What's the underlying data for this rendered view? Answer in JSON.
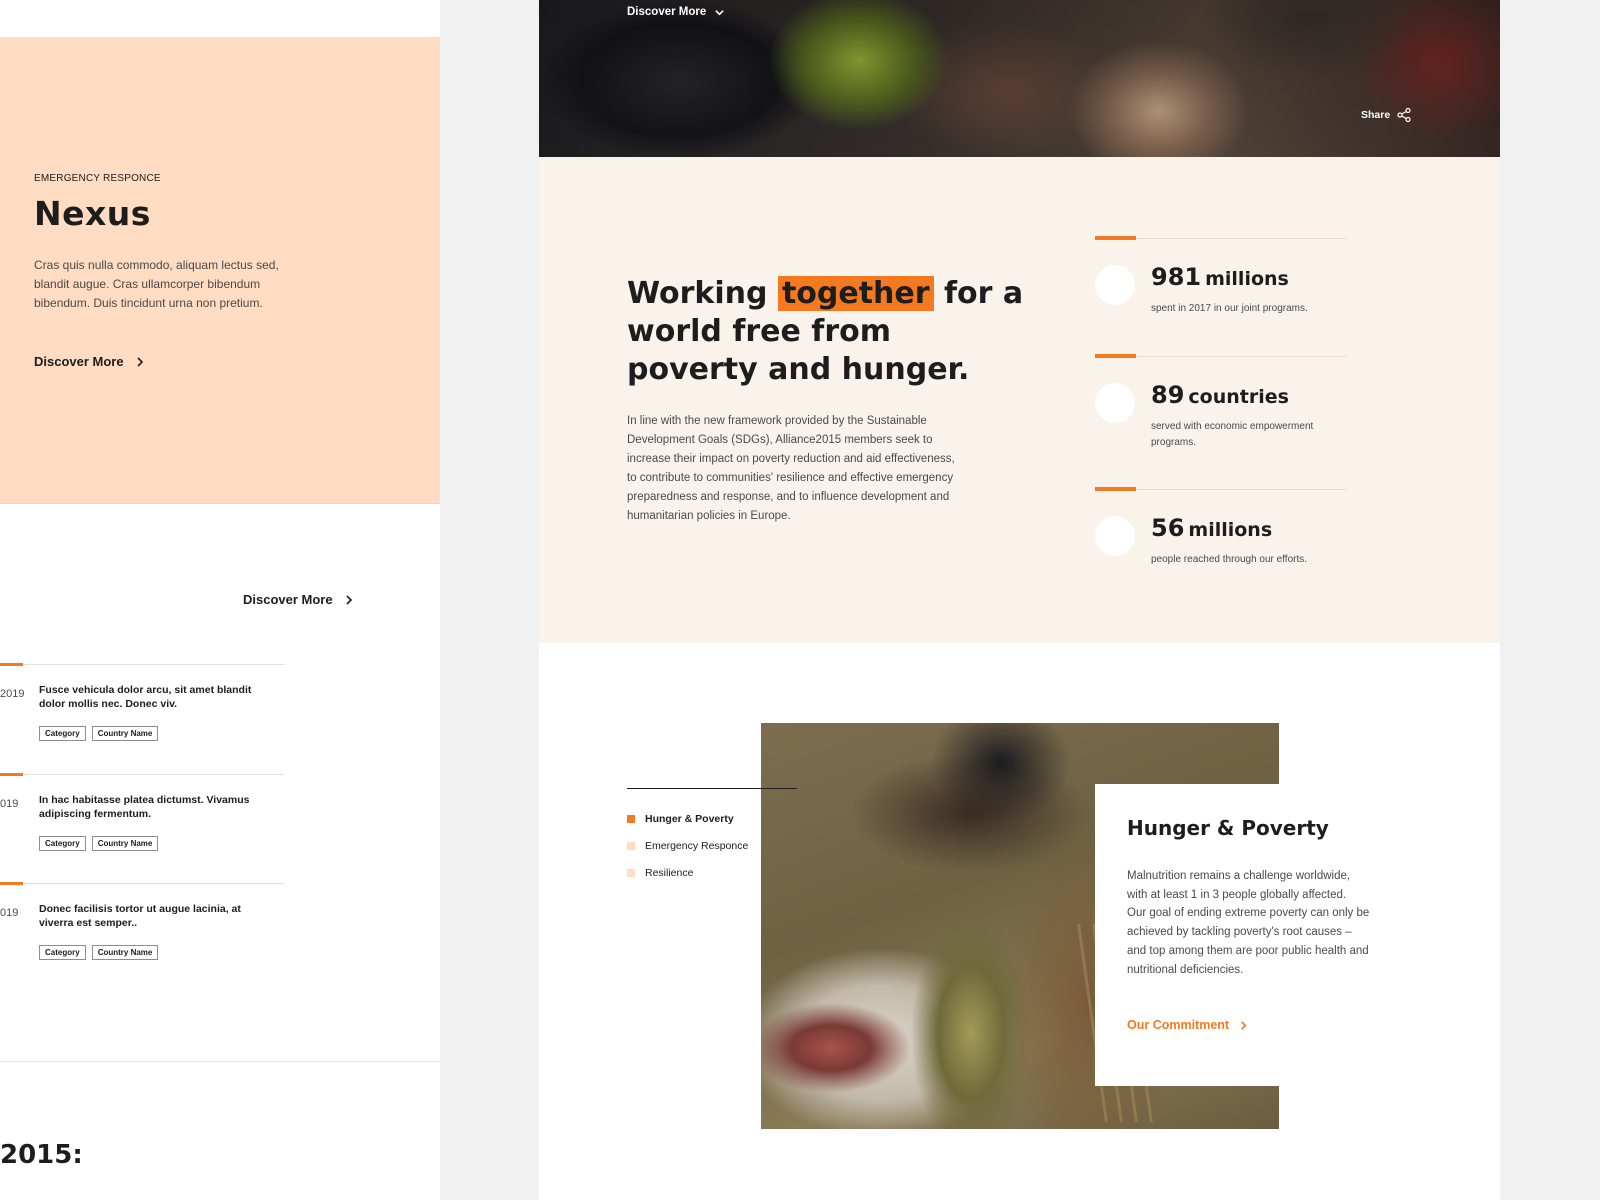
{
  "left_card": {
    "eyebrow": "EMERGENCY RESPONCE",
    "title": "Nexus",
    "body": "Cras quis nulla commodo, aliquam lectus sed, blandit augue. Cras ullamcorper bibendum bibendum. Duis tincidunt urna non pretium.",
    "link_label": "Discover More"
  },
  "left_section": {
    "link_label": "Discover More",
    "news": [
      {
        "date": "2019",
        "title": "Fusce vehicula dolor arcu, sit amet blandit dolor mollis nec. Donec viv.",
        "tags": [
          "Category",
          "Country Name"
        ]
      },
      {
        "date": "019",
        "title": "In hac habitasse platea dictumst. Vivamus adipiscing fermentum.",
        "tags": [
          "Category",
          "Country Name"
        ]
      },
      {
        "date": "019",
        "title": "Donec facilisis tortor ut augue lacinia, at viverra est semper..",
        "tags": [
          "Category",
          "Country Name"
        ]
      }
    ],
    "bottom_heading": "2015:"
  },
  "hero": {
    "discover_label": "Discover More",
    "share_label": "Share"
  },
  "stats_section": {
    "headline_before": "Working ",
    "headline_highlight": "together",
    "headline_after": " for a world free from poverty and hunger.",
    "intro": "In line with the new framework provided by the Sustainable Development Goals (SDGs), Alliance2015 members seek to increase their impact on poverty reduction and aid effectiveness, to contribute to communities' resilience and effective emergency preparedness and response, and to influence development and humanitarian policies in Europe.",
    "stats": [
      {
        "number": "981",
        "unit": "millions",
        "desc": "spent in 2017 in our joint programs."
      },
      {
        "number": "89",
        "unit": "countries",
        "desc": "served with economic empowerment programs."
      },
      {
        "number": "56",
        "unit": "millions",
        "desc": "people reached through our efforts."
      }
    ]
  },
  "feature": {
    "tabs": [
      "Hunger & Poverty",
      "Emergency Responce",
      "Resilience"
    ],
    "active_tab": 0,
    "card_title": "Hunger & Poverty",
    "card_body": "Malnutrition remains a challenge worldwide,\nwith at least 1 in 3 people globally affected.\nOur goal of ending extreme poverty can only be achieved by tackling poverty's root causes –\n and top among them are poor public health and nutritional deficiencies.",
    "card_link": "Our Commitment"
  },
  "colors": {
    "accent": "#f57a1f",
    "peach": "#ffdcc2",
    "cream": "#faf3ec",
    "text": "#1d1d1d"
  }
}
